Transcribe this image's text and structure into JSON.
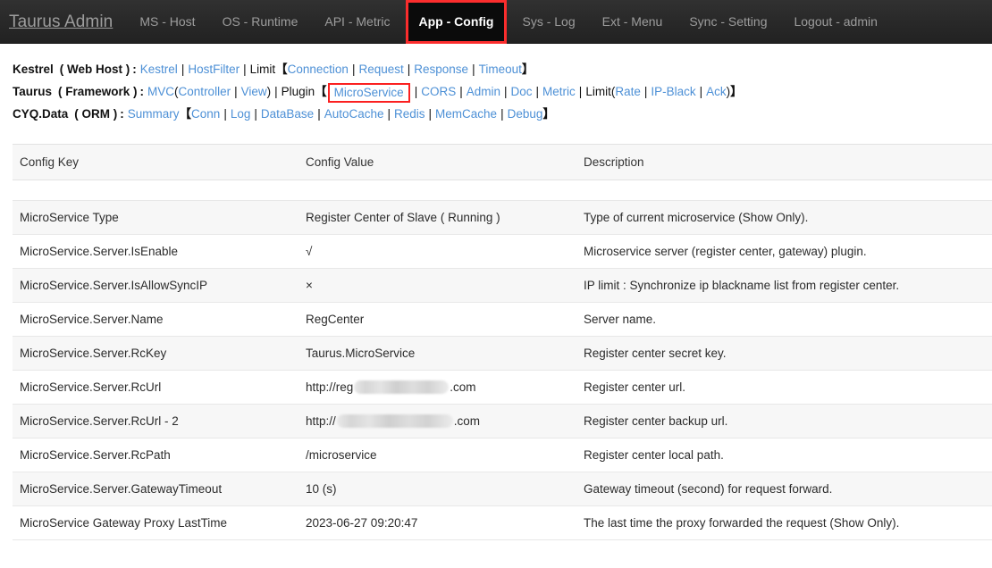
{
  "navbar": {
    "brand": "Taurus Admin",
    "items": [
      {
        "label": "MS - Host",
        "active": false
      },
      {
        "label": "OS - Runtime",
        "active": false
      },
      {
        "label": "API - Metric",
        "active": false
      },
      {
        "label": "App - Config",
        "active": true
      },
      {
        "label": "Sys - Log",
        "active": false
      },
      {
        "label": "Ext - Menu",
        "active": false
      },
      {
        "label": "Sync - Setting",
        "active": false
      },
      {
        "label": "Logout - admin",
        "active": false
      }
    ],
    "accent_color": "#fb2d2d",
    "background_color": "#282828",
    "text_color": "#9d9d9d"
  },
  "link_groups": {
    "row1": {
      "label": "Kestrel",
      "sublabel": "( Web Host )",
      "colon": ":",
      "link_color": "#4d90d6",
      "parts": [
        {
          "type": "link",
          "text": "Kestrel"
        },
        {
          "type": "sep",
          "text": "|"
        },
        {
          "type": "link",
          "text": "HostFilter"
        },
        {
          "type": "sep",
          "text": "|"
        },
        {
          "type": "plain",
          "text": "Limit"
        },
        {
          "type": "brk",
          "text": "【"
        },
        {
          "type": "link",
          "text": "Connection"
        },
        {
          "type": "sep",
          "text": "|"
        },
        {
          "type": "link",
          "text": "Request"
        },
        {
          "type": "sep",
          "text": "|"
        },
        {
          "type": "link",
          "text": "Response"
        },
        {
          "type": "sep",
          "text": "|"
        },
        {
          "type": "link",
          "text": "Timeout"
        },
        {
          "type": "brk",
          "text": "】"
        }
      ]
    },
    "row2": {
      "label": "Taurus",
      "sublabel": "( Framework )",
      "colon": ":",
      "parts": [
        {
          "type": "link",
          "text": "MVC"
        },
        {
          "type": "paren",
          "text": "("
        },
        {
          "type": "link",
          "text": "Controller"
        },
        {
          "type": "sep",
          "text": "|"
        },
        {
          "type": "link",
          "text": "View"
        },
        {
          "type": "paren",
          "text": ")"
        },
        {
          "type": "sep",
          "text": "|"
        },
        {
          "type": "plain",
          "text": "Plugin"
        },
        {
          "type": "brk",
          "text": "【"
        },
        {
          "type": "link-highlight",
          "text": "MicroService"
        },
        {
          "type": "sep",
          "text": "|"
        },
        {
          "type": "link",
          "text": "CORS"
        },
        {
          "type": "sep",
          "text": "|"
        },
        {
          "type": "link",
          "text": "Admin"
        },
        {
          "type": "sep",
          "text": "|"
        },
        {
          "type": "link",
          "text": "Doc"
        },
        {
          "type": "sep",
          "text": "|"
        },
        {
          "type": "link",
          "text": "Metric"
        },
        {
          "type": "sep",
          "text": "|"
        },
        {
          "type": "plain",
          "text": "Limit"
        },
        {
          "type": "paren",
          "text": "("
        },
        {
          "type": "link",
          "text": "Rate"
        },
        {
          "type": "sep",
          "text": "|"
        },
        {
          "type": "link",
          "text": "IP-Black"
        },
        {
          "type": "sep",
          "text": "|"
        },
        {
          "type": "link",
          "text": "Ack"
        },
        {
          "type": "paren",
          "text": ")"
        },
        {
          "type": "brk",
          "text": "】"
        }
      ]
    },
    "row3": {
      "label": "CYQ.Data",
      "sublabel": "( ORM )",
      "colon": ":",
      "parts": [
        {
          "type": "link",
          "text": "Summary"
        },
        {
          "type": "brk",
          "text": "【"
        },
        {
          "type": "link",
          "text": "Conn"
        },
        {
          "type": "sep",
          "text": "|"
        },
        {
          "type": "link",
          "text": "Log"
        },
        {
          "type": "sep",
          "text": "|"
        },
        {
          "type": "link",
          "text": "DataBase"
        },
        {
          "type": "sep",
          "text": "|"
        },
        {
          "type": "link",
          "text": "AutoCache"
        },
        {
          "type": "sep",
          "text": "|"
        },
        {
          "type": "link",
          "text": "Redis"
        },
        {
          "type": "sep",
          "text": "|"
        },
        {
          "type": "link",
          "text": "MemCache"
        },
        {
          "type": "sep",
          "text": "|"
        },
        {
          "type": "link",
          "text": "Debug"
        },
        {
          "type": "brk",
          "text": "】"
        }
      ]
    }
  },
  "table": {
    "headers": [
      "Config Key",
      "Config Value",
      "Description"
    ],
    "rows": [
      {
        "key": "MicroService Type",
        "value": "Register Center of Slave ( Running )",
        "description": "Type of current microservice (Show Only)."
      },
      {
        "key": "MicroService.Server.IsEnable",
        "value": "√",
        "description": "Microservice server (register center, gateway) plugin."
      },
      {
        "key": "MicroService.Server.IsAllowSyncIP",
        "value": "×",
        "description": "IP limit : Synchronize ip blackname list from register center."
      },
      {
        "key": "MicroService.Server.Name",
        "value": "RegCenter",
        "description": "Server name."
      },
      {
        "key": "MicroService.Server.RcKey",
        "value": "Taurus.MicroService",
        "description": "Register center secret key."
      },
      {
        "key": "MicroService.Server.RcUrl",
        "value_prefix": "http://reg",
        "value_redacted": true,
        "value_redact_width": 106,
        "value_suffix": ".com",
        "description": "Register center url."
      },
      {
        "key": "MicroService.Server.RcUrl - 2",
        "value_prefix": "http://",
        "value_redacted": true,
        "value_redact_width": 130,
        "value_suffix": ".com",
        "description": "Register center backup url."
      },
      {
        "key": "MicroService.Server.RcPath",
        "value": "/microservice",
        "description": "Register center local path."
      },
      {
        "key": "MicroService.Server.GatewayTimeout",
        "value": "10 (s)",
        "description": "Gateway timeout (second) for request forward."
      },
      {
        "key": "MicroService Gateway Proxy LastTime",
        "value": "2023-06-27 09:20:47",
        "description": "The last time the proxy forwarded the request (Show Only)."
      }
    ]
  }
}
